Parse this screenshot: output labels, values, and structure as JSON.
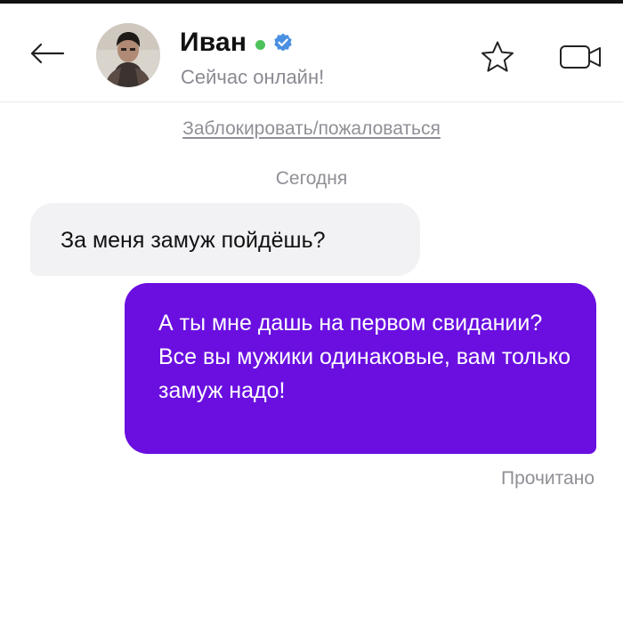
{
  "header": {
    "contact_name": "Иван",
    "status_text": "Сейчас онлайн!",
    "online_color": "#4cc35a",
    "verified_color": "#4a90e2",
    "icons": {
      "back": "back-arrow-icon",
      "favorite": "star-icon",
      "video": "video-camera-icon",
      "verified": "verified-badge-icon"
    }
  },
  "chat": {
    "block_link": "Заблокировать/пожаловаться",
    "date_separator": "Сегодня",
    "messages": [
      {
        "direction": "incoming",
        "text": "За меня замуж пойдёшь?"
      },
      {
        "direction": "outgoing",
        "text": "А ты мне дашь на первом свидании? Все вы мужики одинаковые, вам только замуж надо!"
      }
    ],
    "read_status": "Прочитано",
    "outgoing_bubble_color": "#6a0fe0",
    "incoming_bubble_color": "#f2f2f5"
  }
}
